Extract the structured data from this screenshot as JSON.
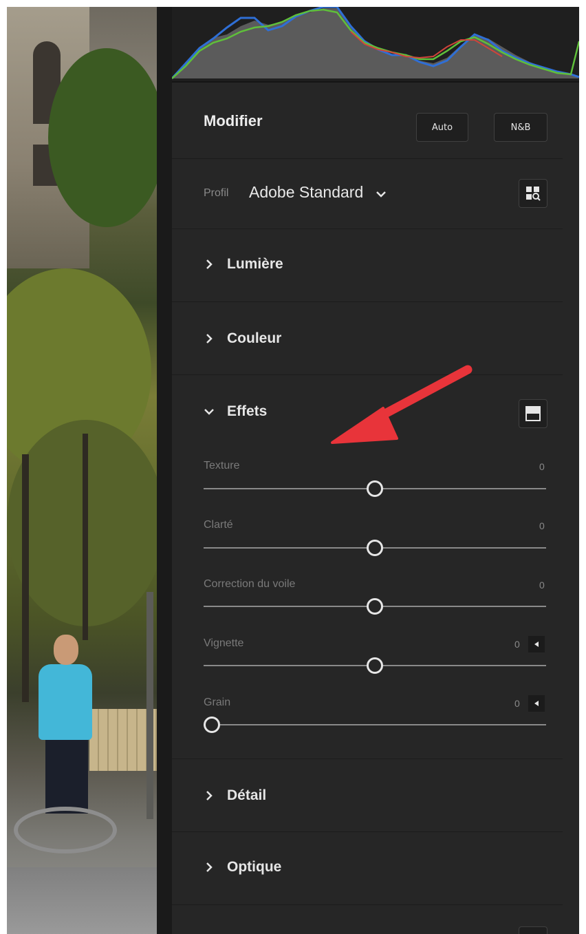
{
  "panel": {
    "title": "Modifier",
    "auto_button": "Auto",
    "bw_button": "N&B",
    "profile_label": "Profil",
    "profile_value": "Adobe Standard"
  },
  "sections": {
    "light": "Lumière",
    "color": "Couleur",
    "effects": "Effets",
    "detail": "Détail",
    "optics": "Optique"
  },
  "effects_sliders": [
    {
      "label": "Texture",
      "value": "0",
      "position": 0.5
    },
    {
      "label": "Clarté",
      "value": "0",
      "position": 0.5
    },
    {
      "label": "Correction du voile",
      "value": "0",
      "position": 0.5
    },
    {
      "label": "Vignette",
      "value": "0",
      "position": 0.5
    },
    {
      "label": "Grain",
      "value": "0",
      "position": 0.0
    }
  ],
  "colors": {
    "panel_bg": "#262626",
    "annotation_arrow": "#e8343a",
    "histogram_blue": "#2f6fd6",
    "histogram_green": "#5fbf3a",
    "histogram_red": "#d0443a"
  }
}
